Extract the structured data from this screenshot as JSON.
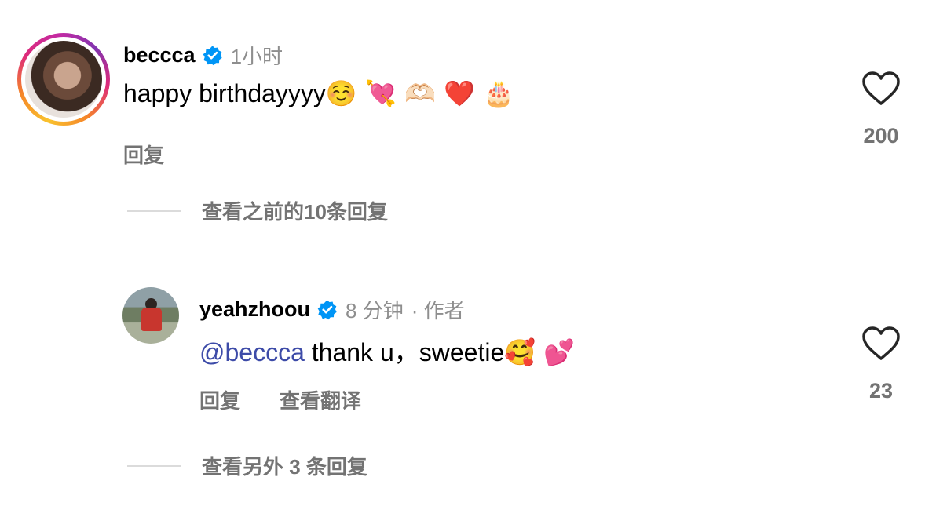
{
  "comments": [
    {
      "username": "beccca",
      "time": "1小时",
      "text": "happy birthdayyyy",
      "emojis": "☺️ 💘 🫶🏻 ❤️ 🎂",
      "reply_label": "回复",
      "likes": "200",
      "view_replies": "查看之前的10条回复"
    },
    {
      "username": "yeahzhoou",
      "time": "8 分钟",
      "author_label": "· 作者",
      "mention": "@beccca",
      "text": " thank u，sweetie",
      "emojis": "🥰 💕",
      "reply_label": "回复",
      "translate_label": "查看翻译",
      "likes": "23",
      "view_replies": "查看另外 3 条回复"
    }
  ],
  "colors": {
    "verified": "#0095f6",
    "mention": "#3d4ba8",
    "secondary_text": "#8e8e8e",
    "action_text": "#737373"
  }
}
